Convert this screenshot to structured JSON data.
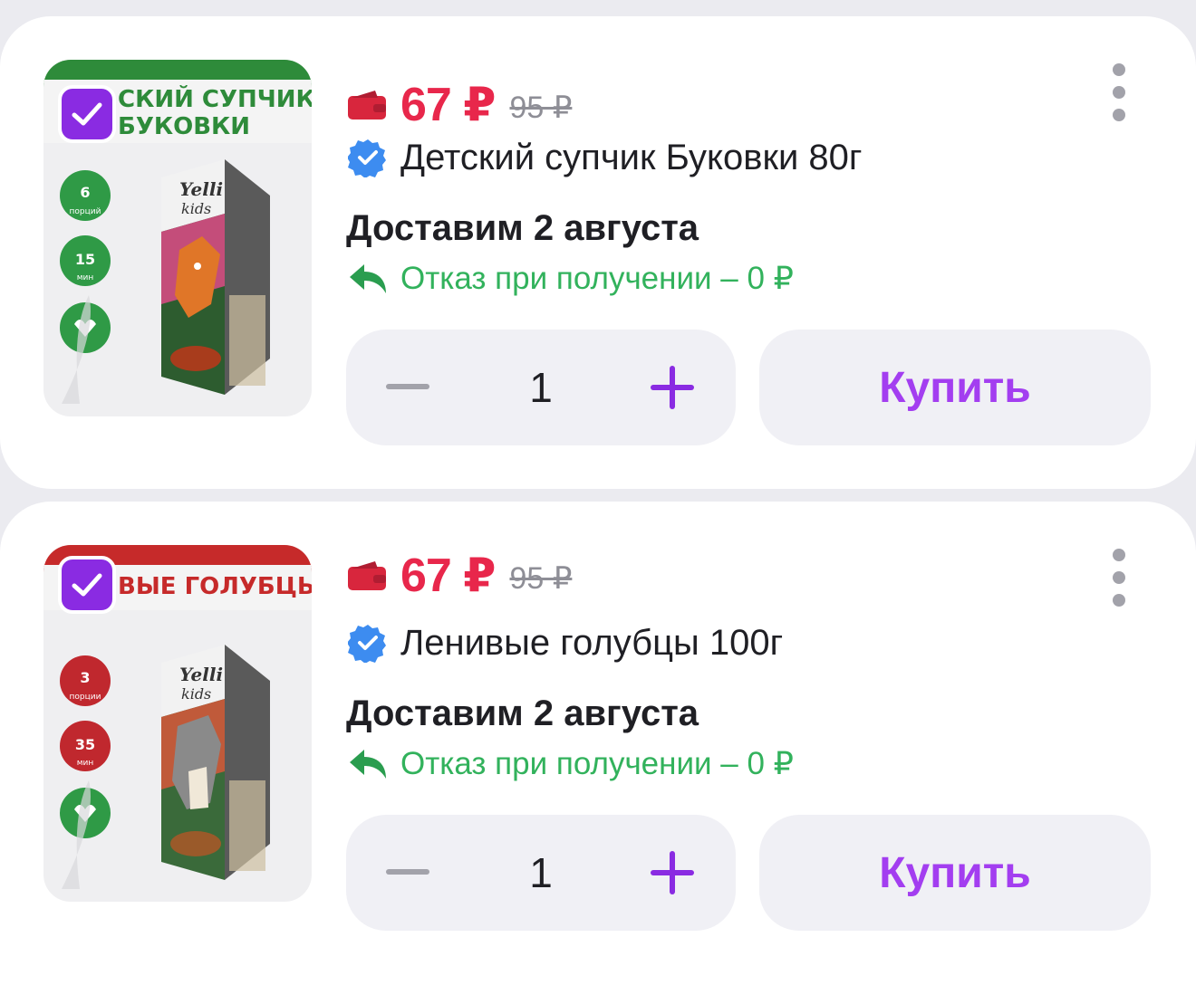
{
  "products": [
    {
      "price": "67 ₽",
      "old_price": "95 ₽",
      "title": "Детский супчик Буковки 80г",
      "delivery": "Доставим 2 августа",
      "return_policy": "Отказ при получении – 0 ₽",
      "quantity": "1",
      "buy_label": "Купить",
      "selected": true,
      "image": {
        "banner_text_1": "СКИЙ СУПЧИК",
        "banner_text_2": "БУКОВКИ",
        "banner_color": "#2e8b3a",
        "brand_1": "Yelli",
        "brand_2": "kids",
        "badge_1_value": "6",
        "badge_1_unit": "порций",
        "badge_2_value": "15",
        "badge_2_unit": "мин",
        "badge_color": "#2f9a46"
      }
    },
    {
      "price": "67 ₽",
      "old_price": "95 ₽",
      "title": "Ленивые голубцы 100г",
      "delivery": "Доставим 2 августа",
      "return_policy": "Отказ при получении – 0 ₽",
      "quantity": "1",
      "buy_label": "Купить",
      "selected": true,
      "image": {
        "banner_text_1": "ВЫЕ ГОЛУБЦЫ",
        "banner_text_2": "",
        "banner_color": "#c62a2a",
        "brand_1": "Yelli",
        "brand_2": "kids",
        "badge_1_value": "3",
        "badge_1_unit": "порции",
        "badge_2_value": "35",
        "badge_2_unit": "мин",
        "badge_color": "#c0282e"
      }
    }
  ],
  "colors": {
    "price": "#e8274b",
    "accent": "#8a2be2",
    "buy_text": "#a33ef0",
    "return_text": "#32b25c",
    "verified": "#3d8cf0"
  },
  "icons": [
    "wallet-icon",
    "verified-icon",
    "return-arrow-icon",
    "kebab-menu-icon",
    "checkmark-icon",
    "minus-icon",
    "plus-icon"
  ]
}
